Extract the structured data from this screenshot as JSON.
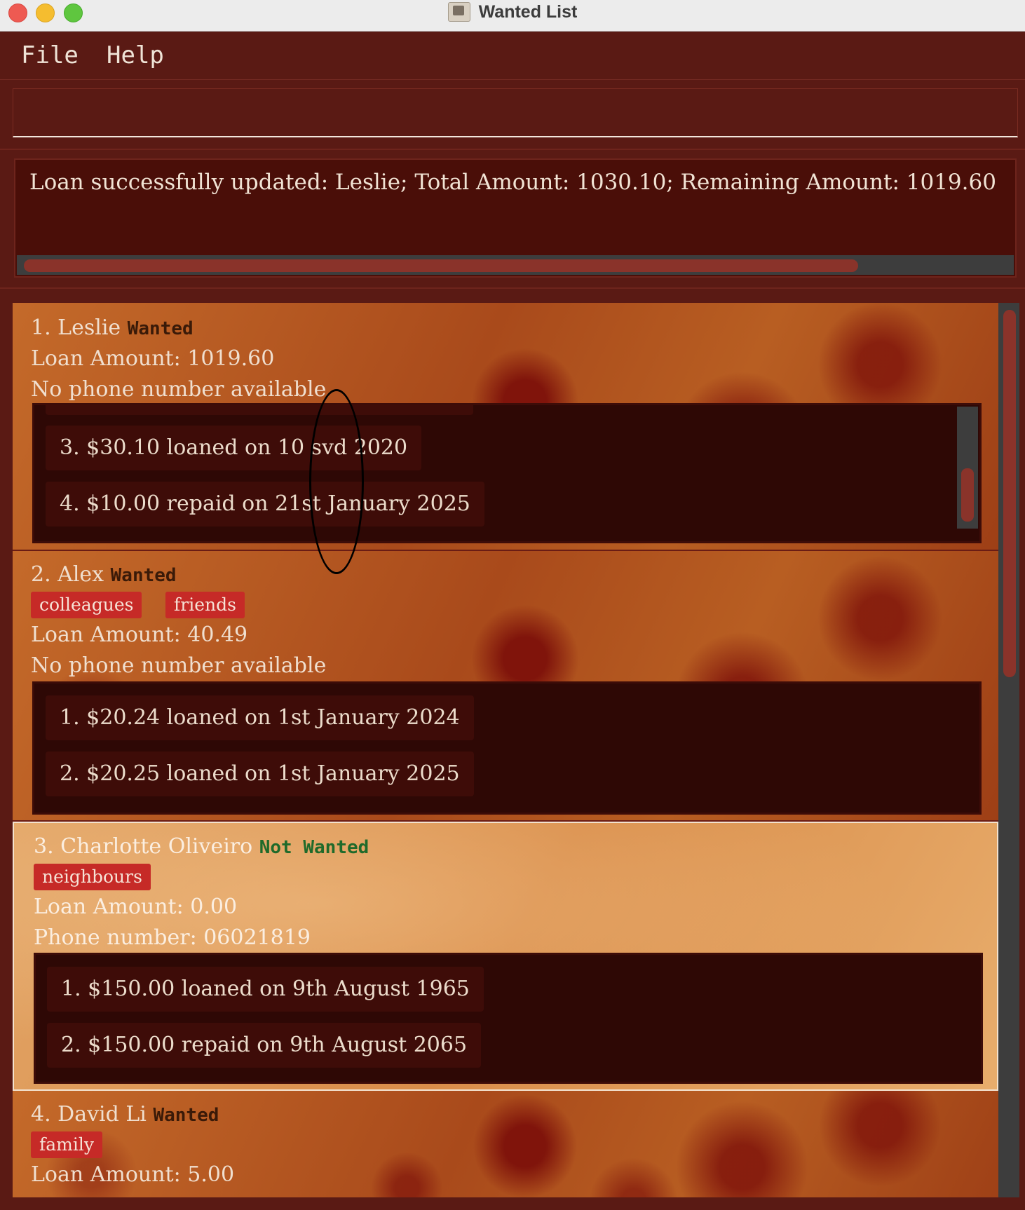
{
  "window": {
    "title": "Wanted List"
  },
  "menu": {
    "file": "File",
    "help": "Help"
  },
  "command": {
    "value": "",
    "placeholder": ""
  },
  "result": {
    "text": "Loan successfully updated: Leslie; Total Amount: 1030.10; Remaining Amount: 1019.60"
  },
  "colors": {
    "accent": "#c62a27",
    "background": "#5a1a14",
    "wanted": "#3a1a08",
    "not_wanted": "#1f6a2a"
  },
  "persons": [
    {
      "name": "1. Leslie",
      "status": "Wanted",
      "tags": [],
      "loan_amount": "Loan Amount: 1019.60",
      "phone": "No phone number available",
      "loans": [
        "3. $30.10 loaned on 10 svd 2020",
        "4. $10.00 repaid on 21st January 2025"
      ]
    },
    {
      "name": "2. Alex",
      "status": "Wanted",
      "tags": [
        "colleagues",
        "friends"
      ],
      "loan_amount": "Loan Amount: 40.49",
      "phone": "No phone number available",
      "loans": [
        "1. $20.24 loaned on 1st January 2024",
        "2. $20.25 loaned on 1st January 2025"
      ]
    },
    {
      "name": "3. Charlotte Oliveiro",
      "status": "Not Wanted",
      "tags": [
        "neighbours"
      ],
      "loan_amount": "Loan Amount: 0.00",
      "phone": "Phone number: 06021819",
      "loans": [
        "1. $150.00 loaned on 9th August 1965",
        "2. $150.00 repaid on 9th August 2065"
      ]
    },
    {
      "name": "4. David Li",
      "status": "Wanted",
      "tags": [
        "family"
      ],
      "loan_amount": "Loan Amount: 5.00"
    }
  ]
}
